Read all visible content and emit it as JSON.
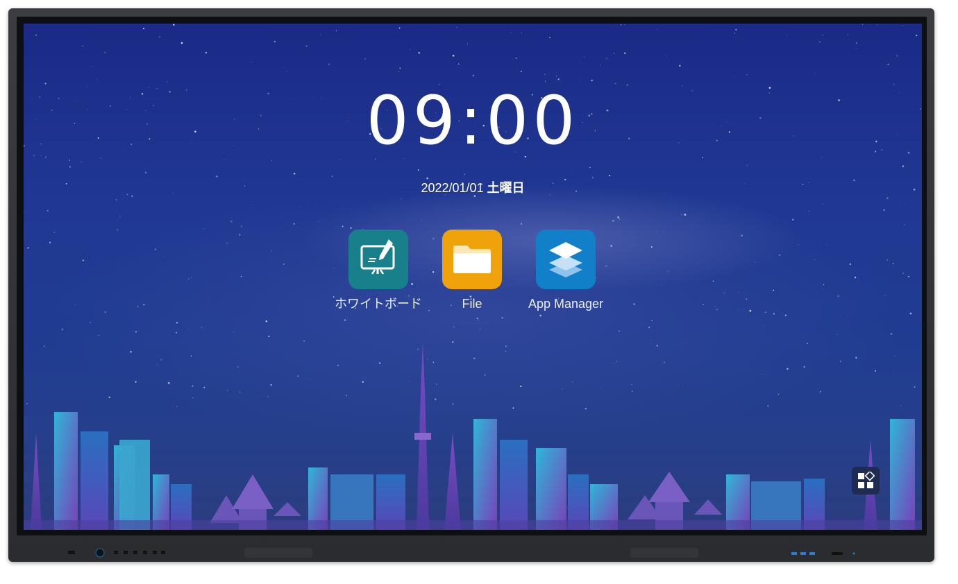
{
  "home": {
    "time": "09:00",
    "date": "2022/01/01",
    "weekday": "土曜日"
  },
  "apps": [
    {
      "label": "ホワイトボード",
      "icon": "whiteboard-icon",
      "color": "#17808b"
    },
    {
      "label": "File",
      "icon": "folder-icon",
      "color": "#f0a20a"
    },
    {
      "label": "App Manager",
      "icon": "layers-icon",
      "color": "#1280c9"
    }
  ],
  "dock": {
    "app_drawer_icon": "app-drawer-icon"
  },
  "colors": {
    "sky_top": "#1a2a86",
    "sky_bottom": "#2b3d7e",
    "bezel": "#2f3134"
  }
}
